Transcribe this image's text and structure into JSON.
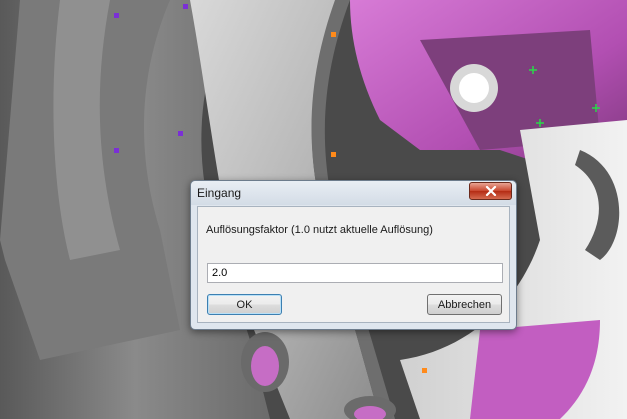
{
  "dialog": {
    "title": "Eingang",
    "close_icon": "close-x-icon",
    "prompt": "Auflösungsfaktor (1.0 nutzt aktuelle Auflösung)",
    "input_value": "2.0",
    "ok_label": "OK",
    "cancel_label": "Abbrechen"
  },
  "colors": {
    "surface_magenta": "#c55ec4",
    "part_gray": "#a9a9a9",
    "close_red": "#c8452d"
  }
}
